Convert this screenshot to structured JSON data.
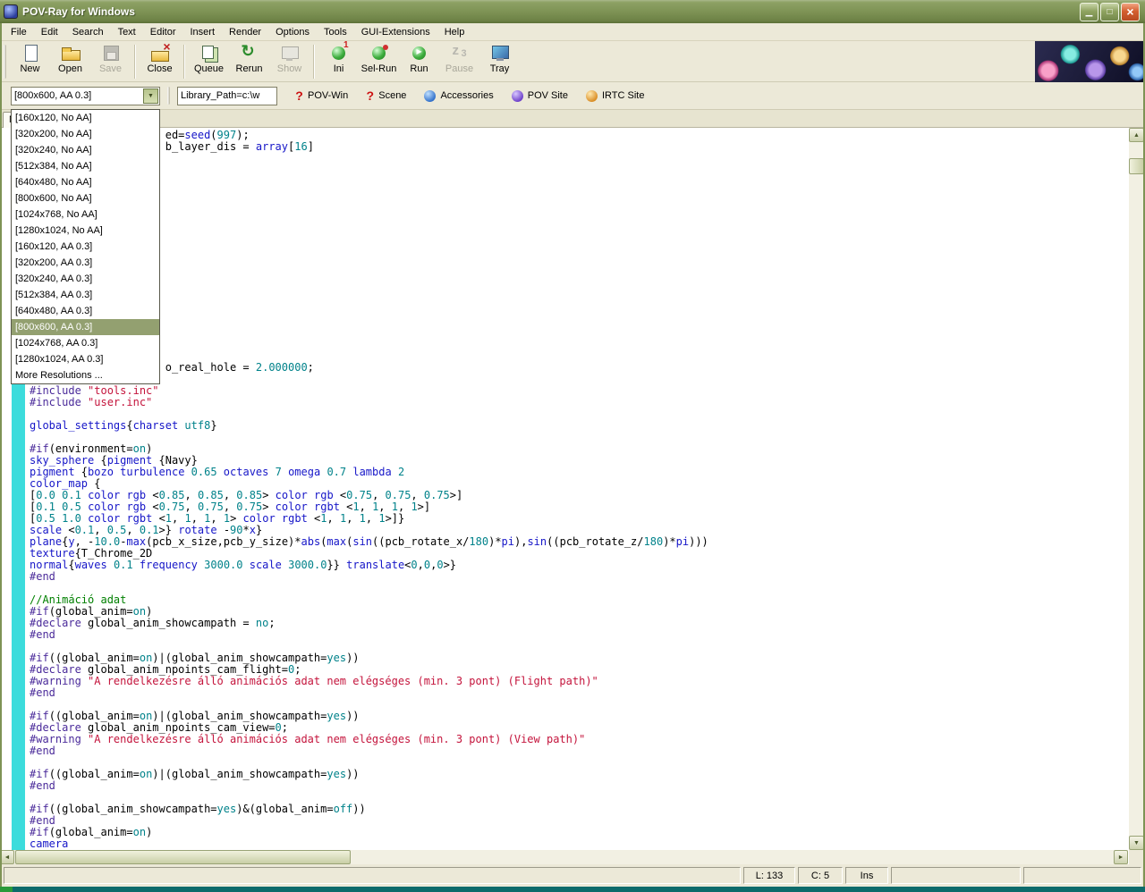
{
  "window": {
    "title": "POV-Ray for Windows"
  },
  "icons": {
    "minimize": "▁",
    "maximize": "□",
    "close": "×",
    "dropdown_arrow": "▼",
    "scroll_up": "▲",
    "scroll_down": "▼",
    "scroll_left": "◄",
    "scroll_right": "►"
  },
  "colors": {
    "titlebar_olive": "#7e9355",
    "close_button": "#d45f30",
    "selection_highlight": "#93a070",
    "marker_strip_cyan": "#3cdcdc",
    "taskbar_teal": "#0d6b6b",
    "syntax_directive": "#4a2a9a",
    "syntax_keyword": "#1616c8",
    "syntax_number": "#00828a",
    "syntax_string": "#c4143c",
    "syntax_comment": "#008000"
  },
  "menu": {
    "items": [
      "File",
      "Edit",
      "Search",
      "Text",
      "Editor",
      "Insert",
      "Render",
      "Options",
      "Tools",
      "GUI-Extensions",
      "Help"
    ]
  },
  "toolbar": {
    "buttons": [
      {
        "label": "New",
        "icon": "new-document-icon",
        "enabled": true
      },
      {
        "label": "Open",
        "icon": "open-folder-icon",
        "enabled": true
      },
      {
        "label": "Save",
        "icon": "save-floppy-icon",
        "enabled": false
      },
      {
        "type": "separator"
      },
      {
        "label": "Close",
        "icon": "close-file-icon",
        "enabled": true
      },
      {
        "type": "separator"
      },
      {
        "label": "Queue",
        "icon": "queue-icon",
        "enabled": true
      },
      {
        "label": "Rerun",
        "icon": "rerun-icon",
        "enabled": true
      },
      {
        "label": "Show",
        "icon": "show-render-icon",
        "enabled": false
      },
      {
        "type": "separator"
      },
      {
        "label": "Ini",
        "icon": "ini-file-icon",
        "enabled": true
      },
      {
        "label": "Sel-Run",
        "icon": "sel-run-icon",
        "enabled": true
      },
      {
        "label": "Run",
        "icon": "run-icon",
        "enabled": true
      },
      {
        "label": "Pause",
        "icon": "pause-icon",
        "enabled": false
      },
      {
        "label": "Tray",
        "icon": "tray-icon",
        "enabled": true
      }
    ]
  },
  "toolbar2": {
    "resolution_combo": {
      "value": "[800x600, AA 0.3]"
    },
    "library_path": {
      "value": "Library_Path=c:\\w"
    },
    "links": [
      {
        "name": "pov-win-help",
        "label": "POV-Win",
        "icon": "help-icon",
        "glyph": "?"
      },
      {
        "name": "scene-help",
        "label": "Scene",
        "icon": "help-icon",
        "glyph": "?"
      },
      {
        "name": "accessories",
        "label": "Accessories",
        "icon": "accessories-icon",
        "glyph": ""
      },
      {
        "name": "pov-site",
        "label": "POV Site",
        "icon": "pov-site-icon",
        "glyph": ""
      },
      {
        "name": "irtc-site",
        "label": "IRTC Site",
        "icon": "irtc-site-icon",
        "glyph": ""
      }
    ]
  },
  "dropdown": {
    "selected_index": 13,
    "items": [
      "[160x120, No AA]",
      "[320x200, No AA]",
      "[320x240, No AA]",
      "[512x384, No AA]",
      "[640x480, No AA]",
      "[800x600, No AA]",
      "[1024x768, No AA]",
      "[1280x1024, No AA]",
      "[160x120, AA 0.3]",
      "[320x200, AA 0.3]",
      "[320x240, AA 0.3]",
      "[512x384, AA 0.3]",
      "[640x480, AA 0.3]",
      "[800x600, AA 0.3]",
      "[1024x768, AA 0.3]",
      "[1280x1024, AA 0.3]",
      "More Resolutions ..."
    ]
  },
  "tabbar": {
    "tab_label": "N"
  },
  "statusbar": {
    "line": "L: 133",
    "col": "C: 5",
    "mode": "Ins"
  },
  "editor": {
    "lines": [
      [
        [
          "p",
          "                     ed="
        ],
        [
          "k",
          "seed"
        ],
        [
          "p",
          "("
        ],
        [
          "n",
          "997"
        ],
        [
          "p",
          ");"
        ]
      ],
      [
        [
          "p",
          "                     b_layer_dis = "
        ],
        [
          "k",
          "array"
        ],
        [
          "p",
          "["
        ],
        [
          "n",
          "16"
        ],
        [
          "p",
          "]"
        ]
      ],
      [],
      [],
      [],
      [],
      [],
      [],
      [],
      [],
      [],
      [],
      [],
      [],
      [],
      [],
      [],
      [],
      [],
      [],
      [
        [
          "p",
          "                     o_real_hole = "
        ],
        [
          "n",
          "2.000000"
        ],
        [
          "p",
          ";"
        ]
      ],
      [],
      [
        [
          "d",
          "#include"
        ],
        [
          "p",
          " "
        ],
        [
          "s",
          "\"tools.inc\""
        ]
      ],
      [
        [
          "d",
          "#include"
        ],
        [
          "p",
          " "
        ],
        [
          "s",
          "\"user.inc\""
        ]
      ],
      [],
      [
        [
          "k",
          "global_settings"
        ],
        [
          "p",
          "{"
        ],
        [
          "k",
          "charset"
        ],
        [
          "p",
          " "
        ],
        [
          "n",
          "utf8"
        ],
        [
          "p",
          "}"
        ]
      ],
      [],
      [
        [
          "d",
          "#if"
        ],
        [
          "p",
          "(environment="
        ],
        [
          "n",
          "on"
        ],
        [
          "p",
          ")"
        ]
      ],
      [
        [
          "k",
          "sky_sphere"
        ],
        [
          "p",
          " {"
        ],
        [
          "k",
          "pigment"
        ],
        [
          "p",
          " {Navy}"
        ]
      ],
      [
        [
          "k",
          "pigment"
        ],
        [
          "p",
          " {"
        ],
        [
          "k",
          "bozo"
        ],
        [
          "p",
          " "
        ],
        [
          "k",
          "turbulence"
        ],
        [
          "p",
          " "
        ],
        [
          "n",
          "0.65"
        ],
        [
          "p",
          " "
        ],
        [
          "k",
          "octaves"
        ],
        [
          "p",
          " "
        ],
        [
          "n",
          "7"
        ],
        [
          "p",
          " "
        ],
        [
          "k",
          "omega"
        ],
        [
          "p",
          " "
        ],
        [
          "n",
          "0.7"
        ],
        [
          "p",
          " "
        ],
        [
          "k",
          "lambda"
        ],
        [
          "p",
          " "
        ],
        [
          "n",
          "2"
        ]
      ],
      [
        [
          "k",
          "color_map"
        ],
        [
          "p",
          " {"
        ]
      ],
      [
        [
          "p",
          "["
        ],
        [
          "n",
          "0.0"
        ],
        [
          "p",
          " "
        ],
        [
          "n",
          "0.1"
        ],
        [
          "p",
          " "
        ],
        [
          "k",
          "color"
        ],
        [
          "p",
          " "
        ],
        [
          "k",
          "rgb"
        ],
        [
          "p",
          " <"
        ],
        [
          "n",
          "0.85"
        ],
        [
          "p",
          ", "
        ],
        [
          "n",
          "0.85"
        ],
        [
          "p",
          ", "
        ],
        [
          "n",
          "0.85"
        ],
        [
          "p",
          "> "
        ],
        [
          "k",
          "color"
        ],
        [
          "p",
          " "
        ],
        [
          "k",
          "rgb"
        ],
        [
          "p",
          " <"
        ],
        [
          "n",
          "0.75"
        ],
        [
          "p",
          ", "
        ],
        [
          "n",
          "0.75"
        ],
        [
          "p",
          ", "
        ],
        [
          "n",
          "0.75"
        ],
        [
          "p",
          ">]"
        ]
      ],
      [
        [
          "p",
          "["
        ],
        [
          "n",
          "0.1"
        ],
        [
          "p",
          " "
        ],
        [
          "n",
          "0.5"
        ],
        [
          "p",
          " "
        ],
        [
          "k",
          "color"
        ],
        [
          "p",
          " "
        ],
        [
          "k",
          "rgb"
        ],
        [
          "p",
          " <"
        ],
        [
          "n",
          "0.75"
        ],
        [
          "p",
          ", "
        ],
        [
          "n",
          "0.75"
        ],
        [
          "p",
          ", "
        ],
        [
          "n",
          "0.75"
        ],
        [
          "p",
          "> "
        ],
        [
          "k",
          "color"
        ],
        [
          "p",
          " "
        ],
        [
          "k",
          "rgbt"
        ],
        [
          "p",
          " <"
        ],
        [
          "n",
          "1"
        ],
        [
          "p",
          ", "
        ],
        [
          "n",
          "1"
        ],
        [
          "p",
          ", "
        ],
        [
          "n",
          "1"
        ],
        [
          "p",
          ", "
        ],
        [
          "n",
          "1"
        ],
        [
          "p",
          ">]"
        ]
      ],
      [
        [
          "p",
          "["
        ],
        [
          "n",
          "0.5"
        ],
        [
          "p",
          " "
        ],
        [
          "n",
          "1.0"
        ],
        [
          "p",
          " "
        ],
        [
          "k",
          "color"
        ],
        [
          "p",
          " "
        ],
        [
          "k",
          "rgbt"
        ],
        [
          "p",
          " <"
        ],
        [
          "n",
          "1"
        ],
        [
          "p",
          ", "
        ],
        [
          "n",
          "1"
        ],
        [
          "p",
          ", "
        ],
        [
          "n",
          "1"
        ],
        [
          "p",
          ", "
        ],
        [
          "n",
          "1"
        ],
        [
          "p",
          "> "
        ],
        [
          "k",
          "color"
        ],
        [
          "p",
          " "
        ],
        [
          "k",
          "rgbt"
        ],
        [
          "p",
          " <"
        ],
        [
          "n",
          "1"
        ],
        [
          "p",
          ", "
        ],
        [
          "n",
          "1"
        ],
        [
          "p",
          ", "
        ],
        [
          "n",
          "1"
        ],
        [
          "p",
          ", "
        ],
        [
          "n",
          "1"
        ],
        [
          "p",
          ">]}"
        ]
      ],
      [
        [
          "k",
          "scale"
        ],
        [
          "p",
          " <"
        ],
        [
          "n",
          "0.1"
        ],
        [
          "p",
          ", "
        ],
        [
          "n",
          "0.5"
        ],
        [
          "p",
          ", "
        ],
        [
          "n",
          "0.1"
        ],
        [
          "p",
          ">} "
        ],
        [
          "k",
          "rotate"
        ],
        [
          "p",
          " -"
        ],
        [
          "n",
          "90"
        ],
        [
          "p",
          "*"
        ],
        [
          "k",
          "x"
        ],
        [
          "p",
          "}"
        ]
      ],
      [
        [
          "k",
          "plane"
        ],
        [
          "p",
          "{"
        ],
        [
          "k",
          "y"
        ],
        [
          "p",
          ", -"
        ],
        [
          "n",
          "10.0"
        ],
        [
          "p",
          "-"
        ],
        [
          "k",
          "max"
        ],
        [
          "p",
          "(pcb_x_size,pcb_y_size)*"
        ],
        [
          "k",
          "abs"
        ],
        [
          "p",
          "("
        ],
        [
          "k",
          "max"
        ],
        [
          "p",
          "("
        ],
        [
          "k",
          "sin"
        ],
        [
          "p",
          "((pcb_rotate_x/"
        ],
        [
          "n",
          "180"
        ],
        [
          "p",
          ")*"
        ],
        [
          "k",
          "pi"
        ],
        [
          "p",
          "),"
        ],
        [
          "k",
          "sin"
        ],
        [
          "p",
          "((pcb_rotate_z/"
        ],
        [
          "n",
          "180"
        ],
        [
          "p",
          ")*"
        ],
        [
          "k",
          "pi"
        ],
        [
          "p",
          ")))"
        ]
      ],
      [
        [
          "k",
          "texture"
        ],
        [
          "p",
          "{T_Chrome_2D"
        ]
      ],
      [
        [
          "k",
          "normal"
        ],
        [
          "p",
          "{"
        ],
        [
          "k",
          "waves"
        ],
        [
          "p",
          " "
        ],
        [
          "n",
          "0.1"
        ],
        [
          "p",
          " "
        ],
        [
          "k",
          "frequency"
        ],
        [
          "p",
          " "
        ],
        [
          "n",
          "3000.0"
        ],
        [
          "p",
          " "
        ],
        [
          "k",
          "scale"
        ],
        [
          "p",
          " "
        ],
        [
          "n",
          "3000.0"
        ],
        [
          "p",
          "}} "
        ],
        [
          "k",
          "translate"
        ],
        [
          "p",
          "<"
        ],
        [
          "n",
          "0"
        ],
        [
          "p",
          ","
        ],
        [
          "n",
          "0"
        ],
        [
          "p",
          ","
        ],
        [
          "n",
          "0"
        ],
        [
          "p",
          ">}"
        ]
      ],
      [
        [
          "d",
          "#end"
        ]
      ],
      [],
      [
        [
          "c",
          "//Animáció adat"
        ]
      ],
      [
        [
          "d",
          "#if"
        ],
        [
          "p",
          "(global_anim="
        ],
        [
          "n",
          "on"
        ],
        [
          "p",
          ")"
        ]
      ],
      [
        [
          "d",
          "#declare"
        ],
        [
          "p",
          " global_anim_showcampath = "
        ],
        [
          "n",
          "no"
        ],
        [
          "p",
          ";"
        ]
      ],
      [
        [
          "d",
          "#end"
        ]
      ],
      [],
      [
        [
          "d",
          "#if"
        ],
        [
          "p",
          "((global_anim="
        ],
        [
          "n",
          "on"
        ],
        [
          "p",
          ")|(global_anim_showcampath="
        ],
        [
          "n",
          "yes"
        ],
        [
          "p",
          "))"
        ]
      ],
      [
        [
          "d",
          "#declare"
        ],
        [
          "p",
          " global_anim_npoints_cam_flight="
        ],
        [
          "n",
          "0"
        ],
        [
          "p",
          ";"
        ]
      ],
      [
        [
          "d",
          "#warning"
        ],
        [
          "p",
          " "
        ],
        [
          "s",
          "\"A rendelkezésre álló animációs adat nem elégséges (min. 3 pont) (Flight path)\""
        ]
      ],
      [
        [
          "d",
          "#end"
        ]
      ],
      [],
      [
        [
          "d",
          "#if"
        ],
        [
          "p",
          "((global_anim="
        ],
        [
          "n",
          "on"
        ],
        [
          "p",
          ")|(global_anim_showcampath="
        ],
        [
          "n",
          "yes"
        ],
        [
          "p",
          "))"
        ]
      ],
      [
        [
          "d",
          "#declare"
        ],
        [
          "p",
          " global_anim_npoints_cam_view="
        ],
        [
          "n",
          "0"
        ],
        [
          "p",
          ";"
        ]
      ],
      [
        [
          "d",
          "#warning"
        ],
        [
          "p",
          " "
        ],
        [
          "s",
          "\"A rendelkezésre álló animációs adat nem elégséges (min. 3 pont) (View path)\""
        ]
      ],
      [
        [
          "d",
          "#end"
        ]
      ],
      [],
      [
        [
          "d",
          "#if"
        ],
        [
          "p",
          "((global_anim="
        ],
        [
          "n",
          "on"
        ],
        [
          "p",
          ")|(global_anim_showcampath="
        ],
        [
          "n",
          "yes"
        ],
        [
          "p",
          "))"
        ]
      ],
      [
        [
          "d",
          "#end"
        ]
      ],
      [],
      [
        [
          "d",
          "#if"
        ],
        [
          "p",
          "((global_anim_showcampath="
        ],
        [
          "n",
          "yes"
        ],
        [
          "p",
          ")&(global_anim="
        ],
        [
          "n",
          "off"
        ],
        [
          "p",
          "))"
        ]
      ],
      [
        [
          "d",
          "#end"
        ]
      ],
      [
        [
          "d",
          "#if"
        ],
        [
          "p",
          "(global_anim="
        ],
        [
          "n",
          "on"
        ],
        [
          "p",
          ")"
        ]
      ],
      [
        [
          "k",
          "camera"
        ]
      ]
    ]
  }
}
